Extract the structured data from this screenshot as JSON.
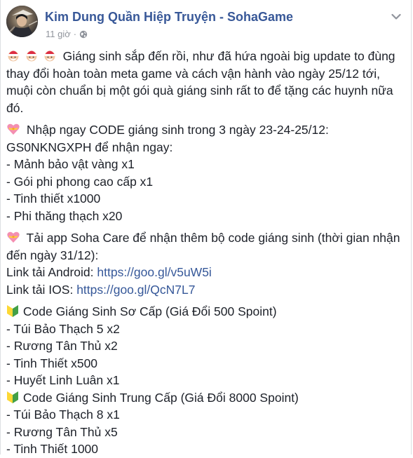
{
  "post": {
    "page_name": "Kim Dung Quần Hiệp Truyện - SohaGame",
    "timestamp": "11 giờ",
    "meta_separator": "·",
    "icons": {
      "avatar": "warrior-avatar",
      "privacy": "globe-icon",
      "menu": "chevron-down-icon",
      "intro": "santa-face-icon",
      "bullet": "heart-ribbon-icon",
      "tier": "beginner-symbol-icon"
    },
    "intro_lines": [
      "Giáng sinh sắp đến rồi, như đã hứa ngoài big update to đùng",
      "thay đổi hoàn toàn meta game và cách vận hành vào ngày 25/12 tới,",
      "muội còn chuẩn bị một gói quà giáng sinh rất to để tặng các huynh nữa",
      "đó."
    ],
    "code_section": {
      "heading": "Nhập ngay CODE giáng sinh trong 3 ngày 23-24-25/12:",
      "code_line": "GS0NKNGXPH để nhận ngay:",
      "items": [
        "- Mảnh bảo vật vàng x1",
        "- Gói phi phong cao cấp x1",
        "- Tinh thiết x1000",
        "- Phi thăng thạch x20"
      ]
    },
    "app_section": {
      "heading_line1": "Tải app Soha Care để nhận thêm bộ code giáng sinh (thời gian nhận",
      "heading_line2": "đến ngày 31/12):",
      "android_label": "Link tải Android: ",
      "android_url": "https://goo.gl/v5uW5i",
      "ios_label": "Link tải IOS: ",
      "ios_url": "https://goo.gl/QcN7L7"
    },
    "tiers": [
      {
        "title": "Code Giáng Sinh Sơ Cấp (Giá Đổi 500 Spoint)",
        "items": [
          "- Túi Bảo Thạch 5 x2",
          "- Rương Tân Thủ x2",
          "- Tinh Thiết x500",
          "- Huyết Linh Luân x1"
        ]
      },
      {
        "title": "Code Giáng Sinh Trung Cấp (Giá Đổi 8000 Spoint)",
        "items": [
          "- Túi Bảo Thạch 8 x1",
          "- Rương Tân Thủ x5",
          "- Tinh Thiết 1000"
        ]
      }
    ],
    "colors": {
      "page_name": "#385898",
      "link": "#365899",
      "text": "#1d2129",
      "meta": "#90949c"
    }
  }
}
